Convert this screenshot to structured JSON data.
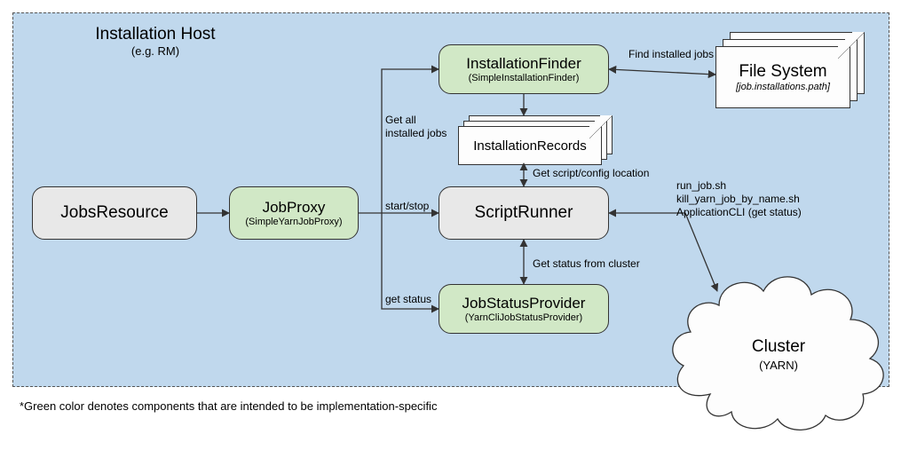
{
  "host": {
    "title": "Installation Host",
    "subtitle": "(e.g. RM)"
  },
  "nodes": {
    "jobsResource": {
      "label": "JobsResource"
    },
    "jobProxy": {
      "label": "JobProxy",
      "sub": "(SimpleYarnJobProxy)"
    },
    "installationFinder": {
      "label": "InstallationFinder",
      "sub": "(SimpleInstallationFinder)"
    },
    "installationRecords": {
      "label": "InstallationRecords"
    },
    "scriptRunner": {
      "label": "ScriptRunner"
    },
    "jobStatusProvider": {
      "label": "JobStatusProvider",
      "sub": "(YarnCliJobStatusProvider)"
    },
    "fileSystem": {
      "label": "File System",
      "sub": "[job.installations.path]"
    },
    "cluster": {
      "label": "Cluster",
      "sub": "(YARN)"
    }
  },
  "edges": {
    "getAllInstalledJobs": "Get all\ninstalled jobs",
    "startStop": "start/stop",
    "getStatus": "get status",
    "findInstalledJobs": "Find installed jobs",
    "getScriptConfig": "Get script/config location",
    "getStatusFromCluster": "Get status from cluster",
    "scriptRunnerCommands": "run_job.sh\nkill_yarn_job_by_name.sh\nApplicationCLI (get status)"
  },
  "footnote": "*Green color denotes components that are intended to be implementation-specific"
}
